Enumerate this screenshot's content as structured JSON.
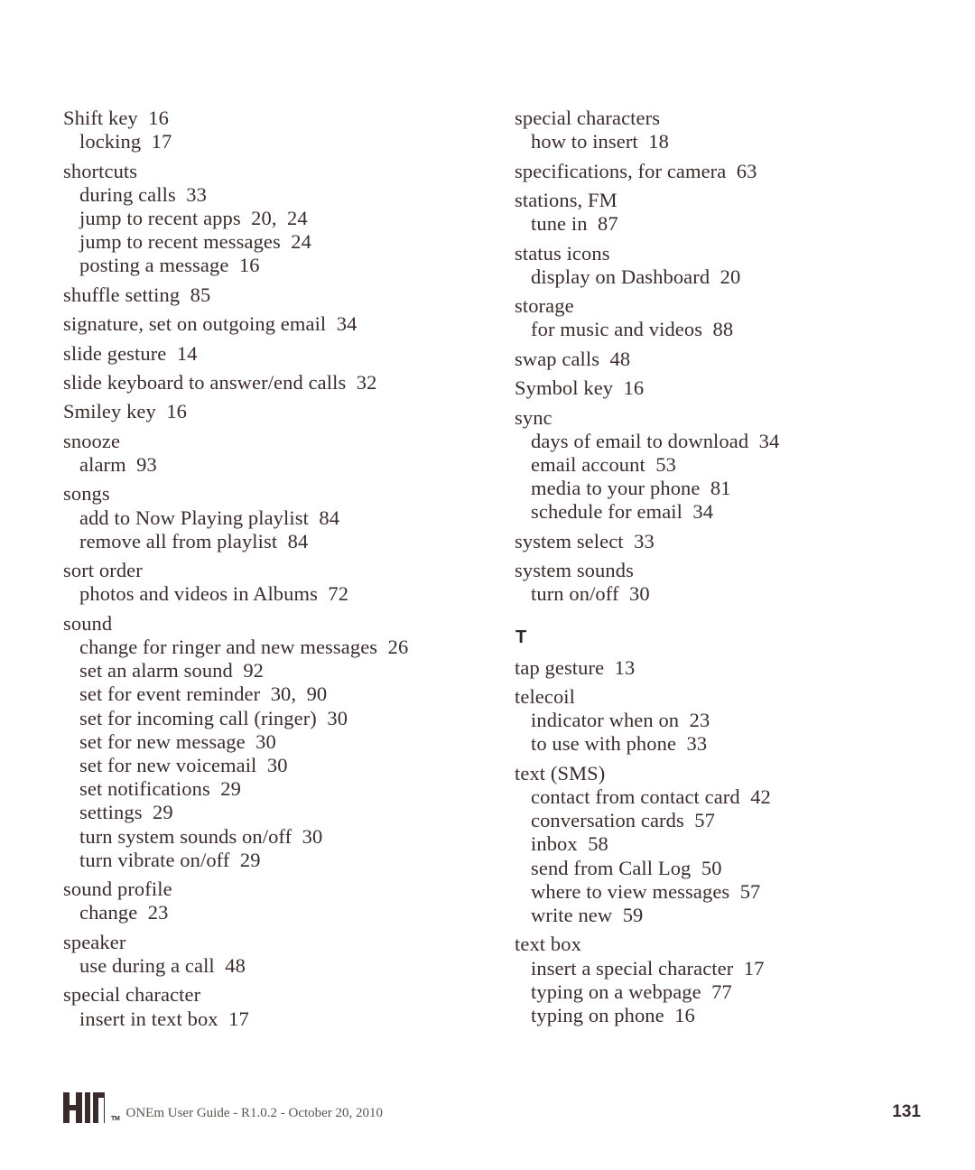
{
  "document": {
    "page_number": "131",
    "footer_text": "ONEm User Guide - R1.0.2 - October 20, 2010",
    "logo_trademark": "TM",
    "text_color": "#3a2c2c",
    "background_color": "#ffffff"
  },
  "columns": [
    {
      "name": "left-column",
      "blocks": [
        {
          "type": "entries",
          "items": [
            {
              "level": 0,
              "text": "Shift key  16"
            },
            {
              "level": 1,
              "text": "locking  17"
            },
            {
              "level": 0,
              "text": "shortcuts"
            },
            {
              "level": 1,
              "text": "during calls  33"
            },
            {
              "level": 1,
              "text": "jump to recent apps  20,  24"
            },
            {
              "level": 1,
              "text": "jump to recent messages  24"
            },
            {
              "level": 1,
              "text": "posting a message  16"
            },
            {
              "level": 0,
              "text": "shuffle setting  85"
            },
            {
              "level": 0,
              "text": "signature, set on outgoing email  34"
            },
            {
              "level": 0,
              "text": "slide gesture  14"
            },
            {
              "level": 0,
              "text": "slide keyboard to answer/end calls  32"
            },
            {
              "level": 0,
              "text": "Smiley key  16"
            },
            {
              "level": 0,
              "text": "snooze"
            },
            {
              "level": 1,
              "text": "alarm  93"
            },
            {
              "level": 0,
              "text": "songs"
            },
            {
              "level": 1,
              "text": "add to Now Playing playlist  84"
            },
            {
              "level": 1,
              "text": "remove all from playlist  84"
            },
            {
              "level": 0,
              "text": "sort order"
            },
            {
              "level": 1,
              "text": "photos and videos in Albums  72"
            },
            {
              "level": 0,
              "text": "sound"
            },
            {
              "level": 1,
              "text": "change for ringer and new messages  26"
            },
            {
              "level": 1,
              "text": "set an alarm sound  92"
            },
            {
              "level": 1,
              "text": "set for event reminder  30,  90"
            },
            {
              "level": 1,
              "text": "set for incoming call (ringer)  30"
            },
            {
              "level": 1,
              "text": "set for new message  30"
            },
            {
              "level": 1,
              "text": "set for new voicemail  30"
            },
            {
              "level": 1,
              "text": "set notifications  29"
            },
            {
              "level": 1,
              "text": "settings  29"
            },
            {
              "level": 1,
              "text": "turn system sounds on/off  30"
            },
            {
              "level": 1,
              "text": "turn vibrate on/off  29"
            },
            {
              "level": 0,
              "text": "sound profile"
            },
            {
              "level": 1,
              "text": "change  23"
            },
            {
              "level": 0,
              "text": "speaker"
            },
            {
              "level": 1,
              "text": "use during a call  48"
            },
            {
              "level": 0,
              "text": "special character"
            },
            {
              "level": 1,
              "text": "insert in text box  17"
            }
          ]
        }
      ]
    },
    {
      "name": "right-column",
      "blocks": [
        {
          "type": "entries",
          "items": [
            {
              "level": 0,
              "text": "special characters"
            },
            {
              "level": 1,
              "text": "how to insert  18"
            },
            {
              "level": 0,
              "text": "specifications, for camera  63"
            },
            {
              "level": 0,
              "text": "stations, FM"
            },
            {
              "level": 1,
              "text": "tune in  87"
            },
            {
              "level": 0,
              "text": "status icons"
            },
            {
              "level": 1,
              "text": "display on Dashboard  20"
            },
            {
              "level": 0,
              "text": "storage"
            },
            {
              "level": 1,
              "text": "for music and videos  88"
            },
            {
              "level": 0,
              "text": "swap calls  48"
            },
            {
              "level": 0,
              "text": "Symbol key  16"
            },
            {
              "level": 0,
              "text": "sync"
            },
            {
              "level": 1,
              "text": "days of email to download  34"
            },
            {
              "level": 1,
              "text": "email account  53"
            },
            {
              "level": 1,
              "text": "media to your phone  81"
            },
            {
              "level": 1,
              "text": "schedule for email  34"
            },
            {
              "level": 0,
              "text": "system select  33"
            },
            {
              "level": 0,
              "text": "system sounds"
            },
            {
              "level": 1,
              "text": "turn on/off  30"
            }
          ]
        },
        {
          "type": "section",
          "letter": "T"
        },
        {
          "type": "entries",
          "items": [
            {
              "level": 0,
              "text": "tap gesture  13"
            },
            {
              "level": 0,
              "text": "telecoil"
            },
            {
              "level": 1,
              "text": "indicator when on  23"
            },
            {
              "level": 1,
              "text": "to use with phone  33"
            },
            {
              "level": 0,
              "text": "text (SMS)"
            },
            {
              "level": 1,
              "text": "contact from contact card  42"
            },
            {
              "level": 1,
              "text": "conversation cards  57"
            },
            {
              "level": 1,
              "text": "inbox  58"
            },
            {
              "level": 1,
              "text": "send from Call Log  50"
            },
            {
              "level": 1,
              "text": "where to view messages  57"
            },
            {
              "level": 1,
              "text": "write new  59"
            },
            {
              "level": 0,
              "text": "text box"
            },
            {
              "level": 1,
              "text": "insert a special character  17"
            },
            {
              "level": 1,
              "text": "typing on a webpage  77"
            },
            {
              "level": 1,
              "text": "typing on phone  16"
            }
          ]
        }
      ]
    }
  ]
}
